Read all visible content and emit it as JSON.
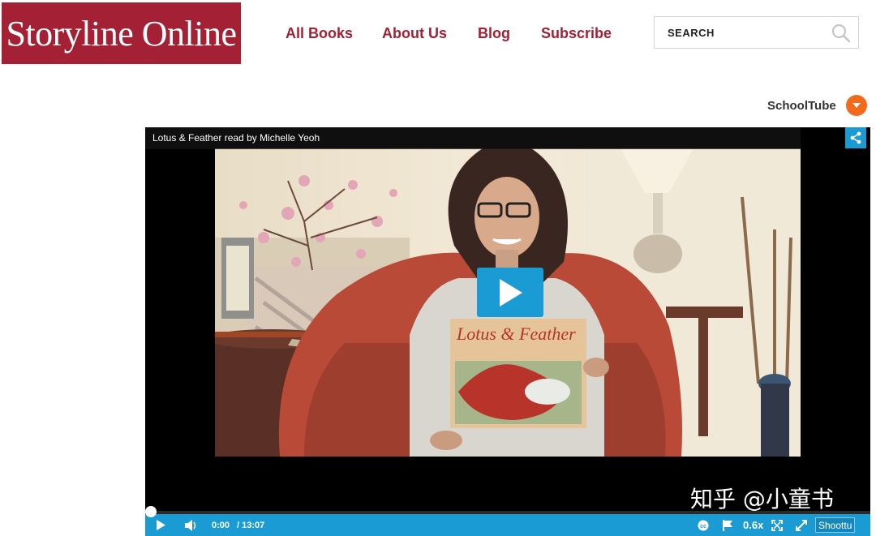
{
  "site": {
    "logo_text": "Storyline Online"
  },
  "nav": [
    {
      "label": "All Books"
    },
    {
      "label": "About Us"
    },
    {
      "label": "Blog"
    },
    {
      "label": "Subscribe"
    }
  ],
  "search": {
    "placeholder": "SEARCH"
  },
  "schooltube": {
    "label": "SchoolTube"
  },
  "video": {
    "title": "Lotus & Feather read by Michelle Yeoh",
    "book_title": "Lotus & Feather",
    "current_time": "0:00",
    "duration": "/ 13:07",
    "speed": "0.6x",
    "progress": 0,
    "badge": "Shoottu",
    "watermark": "知乎 @小童书"
  },
  "colors": {
    "brand": "#a32035",
    "player_accent": "#1b9bd3",
    "schooltube": "#f26b1d"
  },
  "icons": [
    "search-icon",
    "chevron-down-icon",
    "share-icon",
    "play-icon",
    "volume-icon",
    "cc-icon",
    "flag-icon",
    "fullscreen-icon",
    "expand-icon"
  ]
}
